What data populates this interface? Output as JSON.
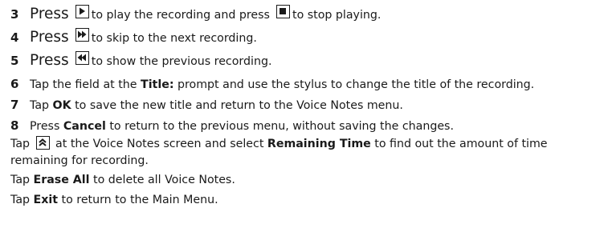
{
  "steps": [
    {
      "num": "3",
      "lead": "Press",
      "mid": "to play the recording and press",
      "tail": "to stop playing."
    },
    {
      "num": "4",
      "lead": "Press",
      "tail": "to skip to the next recording."
    },
    {
      "num": "5",
      "lead": "Press",
      "tail": "to show the previous recording."
    },
    {
      "num": "6",
      "pre": "Tap the field at the",
      "bold": "Title:",
      "post": "prompt and use the stylus to change the title of the recording."
    },
    {
      "num": "7",
      "pre": "Tap",
      "bold": "OK",
      "post": "to save the new title and return to the Voice Notes menu."
    },
    {
      "num": "8",
      "pre": "Press",
      "bold": "Cancel",
      "post": "to return to the previous menu, without saving the changes."
    }
  ],
  "notes": {
    "remaining": {
      "pre": "Tap",
      "mid": "at the Voice Notes screen and select",
      "bold": "Remaining Time",
      "post": "to find out the amount of time",
      "line2": "remaining for recording."
    },
    "erase": {
      "pre": "Tap",
      "bold": "Erase All",
      "post": "to delete all Voice Notes."
    },
    "exit": {
      "pre": "Tap",
      "bold": "Exit",
      "post": "to return to the Main Menu."
    }
  },
  "icons": [
    "play-icon",
    "stop-icon",
    "skip-next-icon",
    "skip-previous-icon",
    "chevron-up-icon"
  ]
}
